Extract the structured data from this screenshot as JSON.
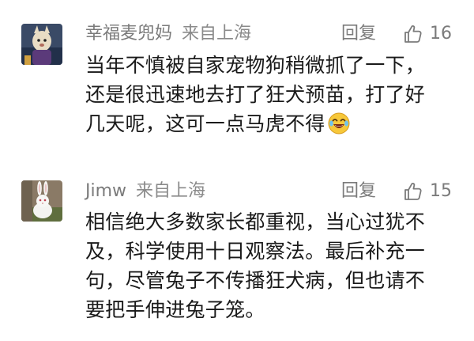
{
  "comments": [
    {
      "avatar_icon": "avatar-cartoon-icon",
      "username": "幸福麦兜妈",
      "location": "来自上海",
      "reply_label": "回复",
      "like_count": "16",
      "text_lines": [
        "当年不慎被自家宠物狗稍微抓了一下，",
        "还是很迅速地去打了狂犬预苗，打了好",
        "几天呢，这可一点马虎不得"
      ],
      "emoji": "laughing-emoji-icon"
    },
    {
      "avatar_icon": "avatar-rabbit-icon",
      "username": "Jimw",
      "location": "来自上海",
      "reply_label": "回复",
      "like_count": "15",
      "text_lines": [
        "相信绝大多数家长都重视，当心过犹不",
        "及，科学使用十日观察法。最后补充一",
        "句，尽管兔子不传播狂犬病，但也请不",
        "要把手伸进兔子笼。"
      ]
    }
  ],
  "colors": {
    "meta_text": "#7b7b7b",
    "body_text": "#1a1a1a",
    "background": "#ffffff"
  }
}
